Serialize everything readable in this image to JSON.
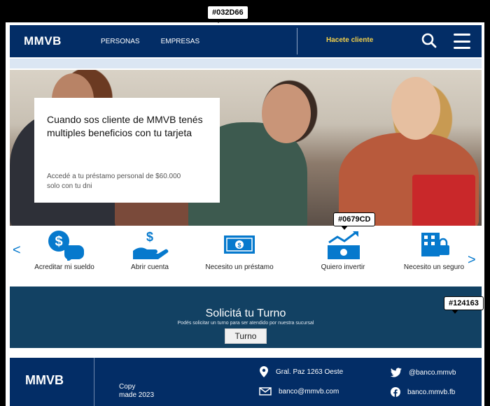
{
  "header": {
    "logo": "MMVB",
    "nav": [
      "PERSONAS",
      "EMPRESAS"
    ],
    "cta": "Hacete cliente"
  },
  "hero": {
    "title": "Cuando sos cliente de MMVB tenés multiples beneficios con tu tarjeta",
    "subtitle": "Accedé a tu préstamo personal de $60.000 solo con tu dni"
  },
  "services": {
    "prev": "<",
    "next": ">",
    "items": [
      {
        "label": "Acreditar mi sueldo",
        "icon": "salary-icon"
      },
      {
        "label": "Abrir cuenta",
        "icon": "open-account-icon"
      },
      {
        "label": "Necesito un préstamo",
        "icon": "loan-icon"
      },
      {
        "label": "Quiero invertir",
        "icon": "invest-icon"
      },
      {
        "label": "Necesito un seguro",
        "icon": "insurance-icon"
      }
    ]
  },
  "turno": {
    "title": "Solicitá tu Turno",
    "subtitle": "Podés solicitar un turno para ser atendido por nuestra sucursal",
    "button": "Turno"
  },
  "footer": {
    "logo": "MMVB",
    "copy_line1": "Copy",
    "copy_line2": "made 2023",
    "address": "Gral. Paz 1263 Oeste",
    "email": "banco@mmvb.com",
    "twitter": "@banco.mmvb",
    "facebook": "banco.mmvb.fb"
  },
  "annotations": {
    "header_color": "#032D66",
    "icon_color": "#0679CD",
    "turno_color": "#124163"
  },
  "colors": {
    "primary": "#032D66",
    "accent": "#0679CD",
    "section": "#124163",
    "cta": "#f2d04b"
  }
}
